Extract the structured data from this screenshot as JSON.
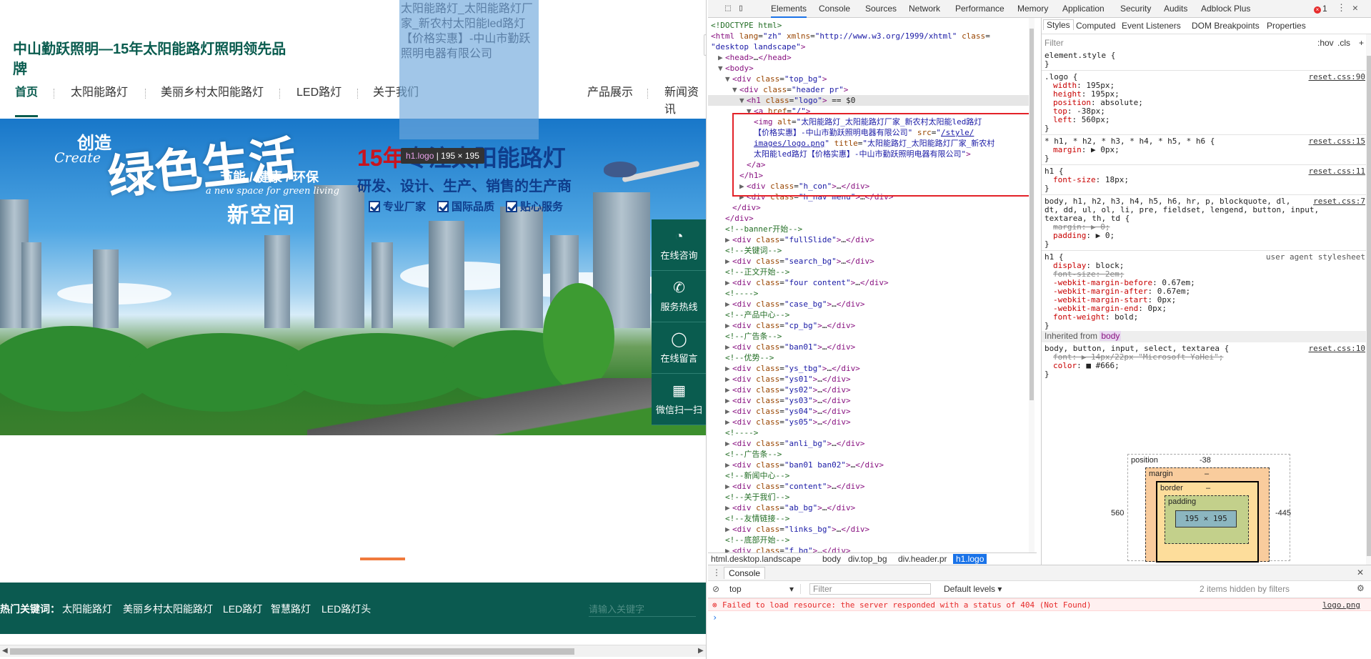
{
  "site": {
    "title": "中山勤跃照明—15年太阳能路灯照明领先品牌",
    "logo_alt": "太阳能路灯_太阳能路灯厂家_新农村太阳能led路灯【价格实惠】-中山市勤跃照明电器有限公司",
    "nav": [
      "首页",
      "太阳能路灯",
      "美丽乡村太阳能路灯",
      "LED路灯",
      "关于我们",
      "产品展示",
      "新闻资讯"
    ],
    "tooltip_selector": "h1.logo",
    "tooltip_size": "195 × 195",
    "banner": {
      "chuangzao": "创造",
      "create": "Create",
      "big": "绿色生活",
      "xinkongjian": "新空间",
      "jieneng": "节能 / 健康 / 环保",
      "newspace": "a new space for green living",
      "headline_num": "15年",
      "headline_text": "专注太阳能路灯",
      "sub": "研发、设计、生产、销售的生产商",
      "badges": [
        "专业厂家",
        "国际品质",
        "贴心服务"
      ]
    },
    "sidebar": [
      {
        "label": "在线咨询",
        "icon": "chat-bubble-icon"
      },
      {
        "label": "服务热线",
        "icon": "phone-icon"
      },
      {
        "label": "在线留言",
        "icon": "message-icon"
      },
      {
        "label": "微信扫一扫",
        "icon": "qr-code-icon"
      }
    ],
    "hot": {
      "label": "热门关键词：",
      "keywords": [
        "太阳能路灯",
        "美丽乡村太阳能路灯",
        "LED路灯",
        "智慧路灯",
        "LED路灯头"
      ],
      "search_placeholder": "请输入关键字"
    }
  },
  "devtools": {
    "tabs": [
      "Elements",
      "Console",
      "Sources",
      "Network",
      "Performance",
      "Memory",
      "Application",
      "Security",
      "Audits",
      "Adblock Plus"
    ],
    "error_count": "1",
    "dom_lines": [
      {
        "indent": 0,
        "html": "<span class='cmt'>&lt;!DOCTYPE html&gt;</span>"
      },
      {
        "indent": 0,
        "html": "<span class='tag'>&lt;html</span> <span class='attr'>lang</span>=<span class='val'>\"zh\"</span> <span class='attr'>xmlns</span>=<span class='val'>\"http://www.w3.org/1999/xhtml\"</span> <span class='attr'>class</span>="
      },
      {
        "indent": 0,
        "html": "<span class='val'>\"desktop landscape\"</span><span class='tag'>&gt;</span>"
      },
      {
        "indent": 1,
        "html": "<span class='tri'>▶</span><span class='tag'>&lt;head&gt;</span>…<span class='tag'>&lt;/head&gt;</span>"
      },
      {
        "indent": 1,
        "html": "<span class='tri'>▼</span><span class='tag'>&lt;body&gt;</span>"
      },
      {
        "indent": 2,
        "html": "<span class='tri'>▼</span><span class='tag'>&lt;div</span> <span class='attr'>class</span>=<span class='val'>\"top_bg\"</span><span class='tag'>&gt;</span>"
      },
      {
        "indent": 3,
        "html": "<span class='tri'>▼</span><span class='tag'>&lt;div</span> <span class='attr'>class</span>=<span class='val'>\"header pr\"</span><span class='tag'>&gt;</span>"
      },
      {
        "indent": 4,
        "html": "<span class='tri'>▼</span><span class='tag'>&lt;h1</span> <span class='attr'>class</span>=<span class='val'>\"logo\"</span><span class='tag'>&gt;</span> == $0"
      },
      {
        "indent": 5,
        "html": "<span class='tri'>▼</span><span class='tag'>&lt;a</span> <span class='attr'>href</span>=<span class='val'>\"/\"</span><span class='tag'>&gt;</span>"
      },
      {
        "indent": 6,
        "html": "<span class='tag'>&lt;img</span> <span class='attr'>alt</span>=<span class='val'>\"太阳能路灯_太阳能路灯厂家_新农村太阳能led路灯</span>"
      },
      {
        "indent": 6,
        "html": "<span class='val'>【价格实惠】-中山市勤跃照明电器有限公司\"</span> <span class='attr'>src</span>=<span class='val'>\"</span><span class='link'>/style/</span>"
      },
      {
        "indent": 6,
        "html": "<span class='link'>images/logo.png</span><span class='val'>\"</span> <span class='attr'>title</span>=<span class='val'>\"太阳能路灯_太阳能路灯厂家_新农村</span>"
      },
      {
        "indent": 6,
        "html": "<span class='val'>太阳能led路灯【价格实惠】-中山市勤跃照明电器有限公司\"</span><span class='tag'>&gt;</span>"
      },
      {
        "indent": 5,
        "html": "<span class='tag'>&lt;/a&gt;</span>"
      },
      {
        "indent": 4,
        "html": "<span class='tag'>&lt;/h1&gt;</span>"
      },
      {
        "indent": 4,
        "html": "<span class='tri'>▶</span><span class='tag'>&lt;div</span> <span class='attr'>class</span>=<span class='val'>\"h_con\"</span><span class='tag'>&gt;</span>…<span class='tag'>&lt;/div&gt;</span>"
      },
      {
        "indent": 4,
        "html": "<span class='tri'>▶</span><span class='tag'>&lt;div</span> <span class='attr'>class</span>=<span class='val'>\"h_nav menu\"</span><span class='tag'>&gt;</span>…<span class='tag'>&lt;/div&gt;</span>"
      },
      {
        "indent": 3,
        "html": "<span class='tag'>&lt;/div&gt;</span>"
      },
      {
        "indent": 2,
        "html": "<span class='tag'>&lt;/div&gt;</span>"
      },
      {
        "indent": 2,
        "html": "<span class='cmt'>&lt;!--banner开始--&gt;</span>"
      },
      {
        "indent": 2,
        "html": "<span class='tri'>▶</span><span class='tag'>&lt;div</span> <span class='attr'>class</span>=<span class='val'>\"fullSlide\"</span><span class='tag'>&gt;</span>…<span class='tag'>&lt;/div&gt;</span>"
      },
      {
        "indent": 2,
        "html": "<span class='cmt'>&lt;!--关键词--&gt;</span>"
      },
      {
        "indent": 2,
        "html": "<span class='tri'>▶</span><span class='tag'>&lt;div</span> <span class='attr'>class</span>=<span class='val'>\"search_bg\"</span><span class='tag'>&gt;</span>…<span class='tag'>&lt;/div&gt;</span>"
      },
      {
        "indent": 2,
        "html": "<span class='cmt'>&lt;!--正文开始--&gt;</span>"
      },
      {
        "indent": 2,
        "html": "<span class='tri'>▶</span><span class='tag'>&lt;div</span> <span class='attr'>class</span>=<span class='val'>\"four content\"</span><span class='tag'>&gt;</span>…<span class='tag'>&lt;/div&gt;</span>"
      },
      {
        "indent": 2,
        "html": "<span class='cmt'>&lt;!----&gt;</span>"
      },
      {
        "indent": 2,
        "html": "<span class='tri'>▶</span><span class='tag'>&lt;div</span> <span class='attr'>class</span>=<span class='val'>\"case_bg\"</span><span class='tag'>&gt;</span>…<span class='tag'>&lt;/div&gt;</span>"
      },
      {
        "indent": 2,
        "html": "<span class='cmt'>&lt;!--产品中心--&gt;</span>"
      },
      {
        "indent": 2,
        "html": "<span class='tri'>▶</span><span class='tag'>&lt;div</span> <span class='attr'>class</span>=<span class='val'>\"cp_bg\"</span><span class='tag'>&gt;</span>…<span class='tag'>&lt;/div&gt;</span>"
      },
      {
        "indent": 2,
        "html": "<span class='cmt'>&lt;!--广告条--&gt;</span>"
      },
      {
        "indent": 2,
        "html": "<span class='tri'>▶</span><span class='tag'>&lt;div</span> <span class='attr'>class</span>=<span class='val'>\"ban01\"</span><span class='tag'>&gt;</span>…<span class='tag'>&lt;/div&gt;</span>"
      },
      {
        "indent": 2,
        "html": "<span class='cmt'>&lt;!--优势--&gt;</span>"
      },
      {
        "indent": 2,
        "html": "<span class='tri'>▶</span><span class='tag'>&lt;div</span> <span class='attr'>class</span>=<span class='val'>\"ys_tbg\"</span><span class='tag'>&gt;</span>…<span class='tag'>&lt;/div&gt;</span>"
      },
      {
        "indent": 2,
        "html": "<span class='tri'>▶</span><span class='tag'>&lt;div</span> <span class='attr'>class</span>=<span class='val'>\"ys01\"</span><span class='tag'>&gt;</span>…<span class='tag'>&lt;/div&gt;</span>"
      },
      {
        "indent": 2,
        "html": "<span class='tri'>▶</span><span class='tag'>&lt;div</span> <span class='attr'>class</span>=<span class='val'>\"ys02\"</span><span class='tag'>&gt;</span>…<span class='tag'>&lt;/div&gt;</span>"
      },
      {
        "indent": 2,
        "html": "<span class='tri'>▶</span><span class='tag'>&lt;div</span> <span class='attr'>class</span>=<span class='val'>\"ys03\"</span><span class='tag'>&gt;</span>…<span class='tag'>&lt;/div&gt;</span>"
      },
      {
        "indent": 2,
        "html": "<span class='tri'>▶</span><span class='tag'>&lt;div</span> <span class='attr'>class</span>=<span class='val'>\"ys04\"</span><span class='tag'>&gt;</span>…<span class='tag'>&lt;/div&gt;</span>"
      },
      {
        "indent": 2,
        "html": "<span class='tri'>▶</span><span class='tag'>&lt;div</span> <span class='attr'>class</span>=<span class='val'>\"ys05\"</span><span class='tag'>&gt;</span>…<span class='tag'>&lt;/div&gt;</span>"
      },
      {
        "indent": 2,
        "html": "<span class='cmt'>&lt;!----&gt;</span>"
      },
      {
        "indent": 2,
        "html": "<span class='tri'>▶</span><span class='tag'>&lt;div</span> <span class='attr'>class</span>=<span class='val'>\"anli_bg\"</span><span class='tag'>&gt;</span>…<span class='tag'>&lt;/div&gt;</span>"
      },
      {
        "indent": 2,
        "html": "<span class='cmt'>&lt;!--广告条--&gt;</span>"
      },
      {
        "indent": 2,
        "html": "<span class='tri'>▶</span><span class='tag'>&lt;div</span> <span class='attr'>class</span>=<span class='val'>\"ban01 ban02\"</span><span class='tag'>&gt;</span>…<span class='tag'>&lt;/div&gt;</span>"
      },
      {
        "indent": 2,
        "html": "<span class='cmt'>&lt;!--新闻中心--&gt;</span>"
      },
      {
        "indent": 2,
        "html": "<span class='tri'>▶</span><span class='tag'>&lt;div</span> <span class='attr'>class</span>=<span class='val'>\"content\"</span><span class='tag'>&gt;</span>…<span class='tag'>&lt;/div&gt;</span>"
      },
      {
        "indent": 2,
        "html": "<span class='cmt'>&lt;!--关于我们--&gt;</span>"
      },
      {
        "indent": 2,
        "html": "<span class='tri'>▶</span><span class='tag'>&lt;div</span> <span class='attr'>class</span>=<span class='val'>\"ab_bg\"</span><span class='tag'>&gt;</span>…<span class='tag'>&lt;/div&gt;</span>"
      },
      {
        "indent": 2,
        "html": "<span class='cmt'>&lt;!--友情链接--&gt;</span>"
      },
      {
        "indent": 2,
        "html": "<span class='tri'>▶</span><span class='tag'>&lt;div</span> <span class='attr'>class</span>=<span class='val'>\"links_bg\"</span><span class='tag'>&gt;</span>…<span class='tag'>&lt;/div&gt;</span>"
      },
      {
        "indent": 2,
        "html": "<span class='cmt'>&lt;!--底部开始--&gt;</span>"
      },
      {
        "indent": 2,
        "html": "<span class='tri'>▶</span><span class='tag'>&lt;div</span> <span class='attr'>class</span>=<span class='val'>\"f_bg\"</span><span class='tag'>&gt;</span>…<span class='tag'>&lt;/div&gt;</span>"
      }
    ],
    "breadcrumbs": [
      "html.desktop.landscape",
      "body",
      "div.top_bg",
      "div.header.pr",
      "h1.logo"
    ],
    "styles_tabs": [
      "Styles",
      "Computed",
      "Event Listeners",
      "DOM Breakpoints",
      "Properties"
    ],
    "filter_placeholder": "Filter",
    "hov": ":hov",
    "cls": ".cls",
    "plus": "+",
    "style_lines": [
      {
        "t": "sel",
        "text": "element.style {"
      },
      {
        "t": "close",
        "text": "}"
      },
      {
        "t": "rule"
      },
      {
        "t": "sel",
        "text": ".logo {",
        "src": "reset.css:90"
      },
      {
        "t": "prop",
        "p": "width",
        "v": "195px;"
      },
      {
        "t": "prop",
        "p": "height",
        "v": "195px;"
      },
      {
        "t": "prop",
        "p": "position",
        "v": "absolute;"
      },
      {
        "t": "prop",
        "p": "top",
        "v": "-38px;"
      },
      {
        "t": "prop",
        "p": "left",
        "v": "560px;"
      },
      {
        "t": "close",
        "text": "}"
      },
      {
        "t": "rule"
      },
      {
        "t": "sel",
        "text": "* h1, * h2, * h3, * h4, * h5, * h6 {",
        "src": "reset.css:15"
      },
      {
        "t": "prop",
        "p": "margin",
        "v": "▶ 0px;"
      },
      {
        "t": "close",
        "text": "}"
      },
      {
        "t": "rule"
      },
      {
        "t": "sel",
        "text": "h1 {",
        "src": "reset.css:11"
      },
      {
        "t": "prop",
        "p": "font-size",
        "v": "18px;"
      },
      {
        "t": "close",
        "text": "}"
      },
      {
        "t": "rule"
      },
      {
        "t": "sel",
        "text": "body, h1, h2, h3, h4, h5, h6, hr, p, blockquote, dl,",
        "src": "reset.css:7"
      },
      {
        "t": "sel",
        "text": "dt, dd, ul, ol, li, pre, fieldset, lengend, button, input,"
      },
      {
        "t": "sel",
        "text": "textarea, th, td {"
      },
      {
        "t": "struck",
        "p": "margin",
        "v": "▶ 0;"
      },
      {
        "t": "prop",
        "p": "padding",
        "v": "▶ 0;"
      },
      {
        "t": "close",
        "text": "}"
      },
      {
        "t": "rule"
      },
      {
        "t": "sel",
        "text": "h1 {",
        "ua": "user agent stylesheet"
      },
      {
        "t": "prop",
        "p": "display",
        "v": "block;"
      },
      {
        "t": "struck",
        "p": "font-size",
        "v": "2em;"
      },
      {
        "t": "prop",
        "p": "-webkit-margin-before",
        "v": "0.67em;"
      },
      {
        "t": "prop",
        "p": "-webkit-margin-after",
        "v": "0.67em;"
      },
      {
        "t": "prop",
        "p": "-webkit-margin-start",
        "v": "0px;"
      },
      {
        "t": "prop",
        "p": "-webkit-margin-end",
        "v": "0px;"
      },
      {
        "t": "prop",
        "p": "font-weight",
        "v": "bold;"
      },
      {
        "t": "close",
        "text": "}"
      },
      {
        "t": "inherited",
        "text": "Inherited from",
        "el": "body"
      },
      {
        "t": "sel",
        "text": "body, button, input, select, textarea {",
        "src": "reset.css:10"
      },
      {
        "t": "struck",
        "p": "font",
        "v": "▶ 14px/22px \"Microsoft YaHei\";"
      },
      {
        "t": "prop",
        "p": "color",
        "v": "■ #666;"
      },
      {
        "t": "close",
        "text": "}"
      }
    ],
    "box_model": {
      "position_label": "position",
      "position_top": "-38",
      "position_left": "560",
      "position_right": "-445",
      "margin_label": "margin",
      "border_label": "border",
      "padding_label": "padding",
      "content": "195 × 195",
      "dash": "–"
    },
    "console": {
      "tab": "Console",
      "context": "top",
      "filter_placeholder": "Filter",
      "levels": "Default levels ▾",
      "hidden": "2 items hidden by filters",
      "error": "Failed to load resource: the server responded with a status of 404 (Not Found)",
      "error_src": "logo.png",
      "prompt": "›"
    }
  }
}
